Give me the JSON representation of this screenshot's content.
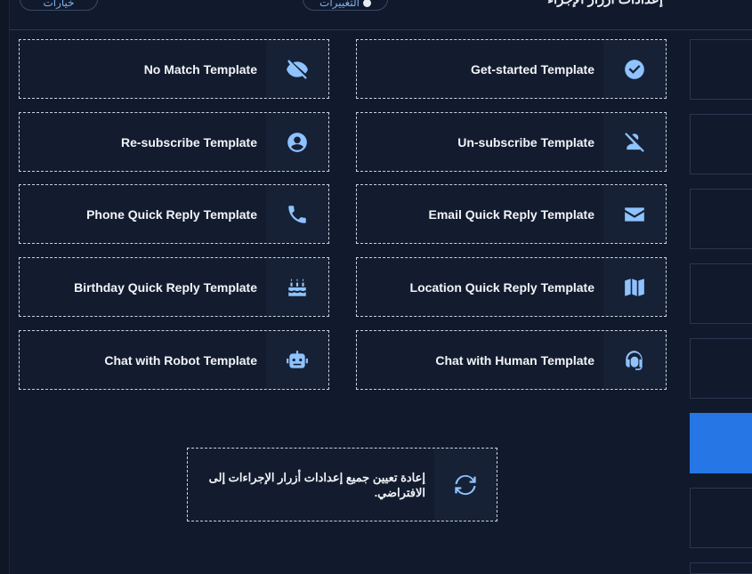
{
  "header": {
    "title": "إعدادات أزرار الإجراء",
    "options_label": "خيارات",
    "changes_label": "التغييرات"
  },
  "templates": [
    {
      "label": "No Match Template",
      "icon": "eye-slash-icon"
    },
    {
      "label": "Get-started Template",
      "icon": "check-circle-icon"
    },
    {
      "label": "Re-subscribe Template",
      "icon": "user-circle-icon"
    },
    {
      "label": "Un-subscribe Template",
      "icon": "user-slash-icon"
    },
    {
      "label": "Phone Quick Reply Template",
      "icon": "phone-icon"
    },
    {
      "label": "Email Quick Reply Template",
      "icon": "envelope-icon"
    },
    {
      "label": "Birthday Quick Reply Template",
      "icon": "birthday-cake-icon"
    },
    {
      "label": "Location Quick Reply Template",
      "icon": "map-icon"
    },
    {
      "label": "Chat with Robot Template",
      "icon": "robot-icon"
    },
    {
      "label": "Chat with Human Template",
      "icon": "headset-icon"
    }
  ],
  "reset": {
    "label": "إعادة تعيين جميع إعدادات أزرار الإجراءات إلى الافتراضي.",
    "icon": "sync-icon"
  },
  "colors": {
    "background": "#111a2c",
    "accent": "#2676e6",
    "icon": "#8ec3ff"
  }
}
